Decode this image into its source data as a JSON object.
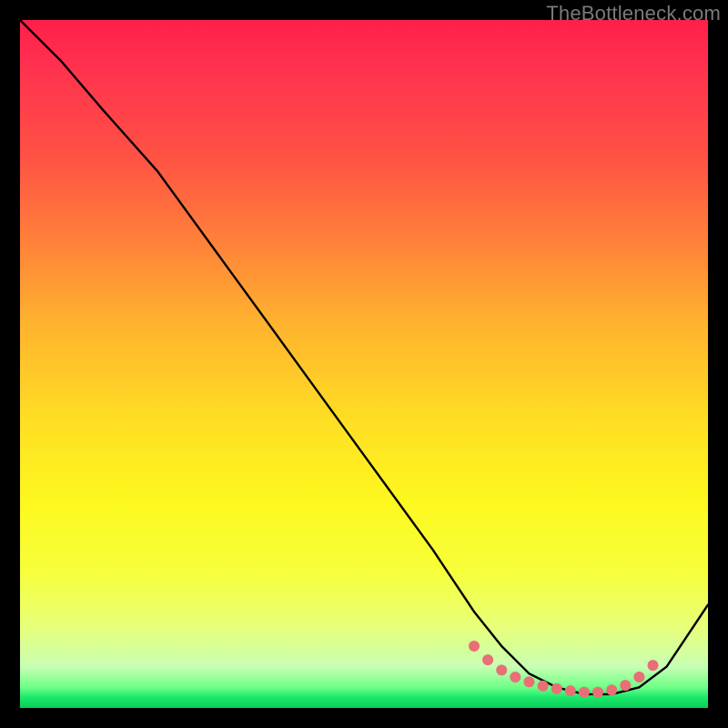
{
  "watermark": "TheBottleneck.com",
  "chart_data": {
    "type": "line",
    "title": "",
    "xlabel": "",
    "ylabel": "",
    "xlim": [
      0,
      100
    ],
    "ylim": [
      0,
      100
    ],
    "series": [
      {
        "name": "curve",
        "x": [
          0,
          6,
          12,
          20,
          28,
          36,
          44,
          52,
          60,
          66,
          70,
          74,
          78,
          82,
          86,
          90,
          94,
          100
        ],
        "y": [
          100,
          94,
          87,
          78,
          67,
          56,
          45,
          34,
          23,
          14,
          9,
          5,
          3,
          2,
          2,
          3,
          6,
          15
        ]
      }
    ],
    "markers": {
      "name": "low-points",
      "x": [
        66,
        68,
        70,
        72,
        74,
        76,
        78,
        80,
        82,
        84,
        86,
        88,
        90,
        92
      ],
      "y": [
        9,
        7,
        5.5,
        4.5,
        3.8,
        3.2,
        2.8,
        2.5,
        2.3,
        2.3,
        2.6,
        3.3,
        4.5,
        6.2
      ],
      "color": "#e96f76",
      "radius": 6
    },
    "colors": {
      "curve": "#000000",
      "marker": "#e96f76",
      "gradient_top": "#ff1f4a",
      "gradient_bottom": "#0acc58"
    }
  }
}
